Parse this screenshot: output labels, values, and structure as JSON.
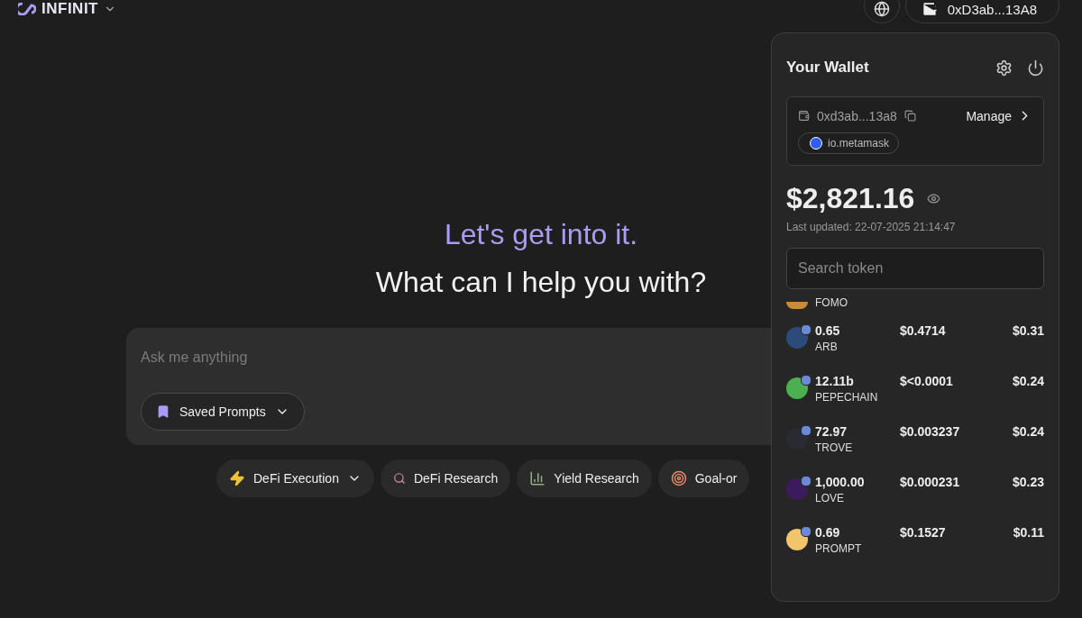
{
  "brand": {
    "name": "INFINIT"
  },
  "top_bar": {
    "wallet_address": "0xD3ab...13A8"
  },
  "hero": {
    "greeting": "Let's get into it.",
    "question": "What can I help you with?"
  },
  "prompt": {
    "placeholder": "Ask me anything",
    "saved_prompts": "Saved Prompts"
  },
  "chips": [
    {
      "label": "DeFi Execution",
      "kind": "bolt",
      "dropdown": true
    },
    {
      "label": "DeFi Research",
      "kind": "search",
      "dropdown": false
    },
    {
      "label": "Yield Research",
      "kind": "bars",
      "dropdown": false
    },
    {
      "label": "Goal-or",
      "kind": "target",
      "dropdown": false
    }
  ],
  "wallet": {
    "title": "Your Wallet",
    "address": "0xd3ab...13a8",
    "manage": "Manage",
    "provider": "io.metamask",
    "balance": "$2,821.16",
    "last_updated": "Last updated: 22-07-2025 21:14:47",
    "search_placeholder": "Search token",
    "tokens": [
      {
        "symbol": "FOMO",
        "color": "#c98a3a",
        "partial": true
      },
      {
        "amount": "0.65",
        "symbol": "ARB",
        "price": "$0.4714",
        "value": "$0.31",
        "color": "#2d4b7a",
        "partial": false
      },
      {
        "amount": "12.11b",
        "symbol": "PEPECHAIN",
        "price": "$<0.0001",
        "value": "$0.24",
        "color": "#4caf50",
        "partial": false
      },
      {
        "amount": "72.97",
        "symbol": "TROVE",
        "price": "$0.003237",
        "value": "$0.24",
        "color": "#2a2a33",
        "partial": false
      },
      {
        "amount": "1,000.00",
        "symbol": "LOVE",
        "price": "$0.000231",
        "value": "$0.23",
        "color": "#3b1a5e",
        "partial": false
      },
      {
        "amount": "0.69",
        "symbol": "PROMPT",
        "price": "$0.1527",
        "value": "$0.11",
        "color": "#f2c46b",
        "partial": false
      }
    ]
  }
}
